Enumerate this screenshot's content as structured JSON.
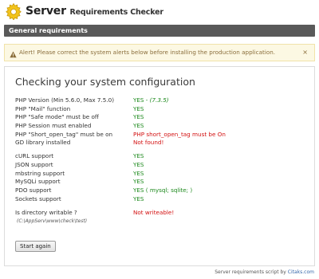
{
  "header": {
    "logo_icon": "gear-icon",
    "title_main": "Server",
    "title_sub": "Requirements Checker"
  },
  "section": {
    "title": "General requirements"
  },
  "alert": {
    "icon": "warning-icon",
    "message": "Alert! Please correct the system alerts below before installing the production application.",
    "close_label": "×"
  },
  "main": {
    "title": "Checking your system configuration",
    "groups": [
      [
        {
          "label": "PHP Version (Min 5.6.0, Max 7.5.0)",
          "status": "YES",
          "status_class": "ok",
          "detail": " - ",
          "detail_em": "(7.3.5)"
        },
        {
          "label": "PHP \"Mail\" function",
          "status": "YES",
          "status_class": "ok",
          "detail": "",
          "detail_em": ""
        },
        {
          "label": "PHP \"Safe mode\" must be off",
          "status": "YES",
          "status_class": "ok",
          "detail": "",
          "detail_em": ""
        },
        {
          "label": "PHP Session must enabled",
          "status": "YES",
          "status_class": "ok",
          "detail": "",
          "detail_em": ""
        },
        {
          "label": "PHP \"Short_open_tag\" must be on",
          "status": "PHP short_open_tag must be On",
          "status_class": "err",
          "detail": "",
          "detail_em": ""
        },
        {
          "label": "GD library installed",
          "status": "Not found!",
          "status_class": "err",
          "detail": "",
          "detail_em": ""
        }
      ],
      [
        {
          "label": "cURL support",
          "status": "YES",
          "status_class": "ok",
          "detail": "",
          "detail_em": ""
        },
        {
          "label": "JSON support",
          "status": "YES",
          "status_class": "ok",
          "detail": "",
          "detail_em": ""
        },
        {
          "label": "mbstring support",
          "status": "YES",
          "status_class": "ok",
          "detail": "",
          "detail_em": ""
        },
        {
          "label": "MySQLi support",
          "status": "YES",
          "status_class": "ok",
          "detail": "",
          "detail_em": ""
        },
        {
          "label": "PDO support",
          "status": "YES",
          "status_class": "ok",
          "detail": " ( mysql; sqlite; )",
          "detail_em": ""
        },
        {
          "label": "Sockets support",
          "status": "YES",
          "status_class": "ok",
          "detail": "",
          "detail_em": ""
        }
      ]
    ],
    "writable": {
      "label": "Is directory writable ?",
      "status": "Not writeable!",
      "path": "(C:\\AppServ\\www\\check\\test)"
    },
    "button_label": "Start again"
  },
  "footer": {
    "text": "Server requirements script by ",
    "link_text": "Citaks.com"
  },
  "colors": {
    "ok": "#1e8a1e",
    "error": "#d31111",
    "section_bar": "#595959",
    "alert_bg": "#fcf8e3"
  }
}
